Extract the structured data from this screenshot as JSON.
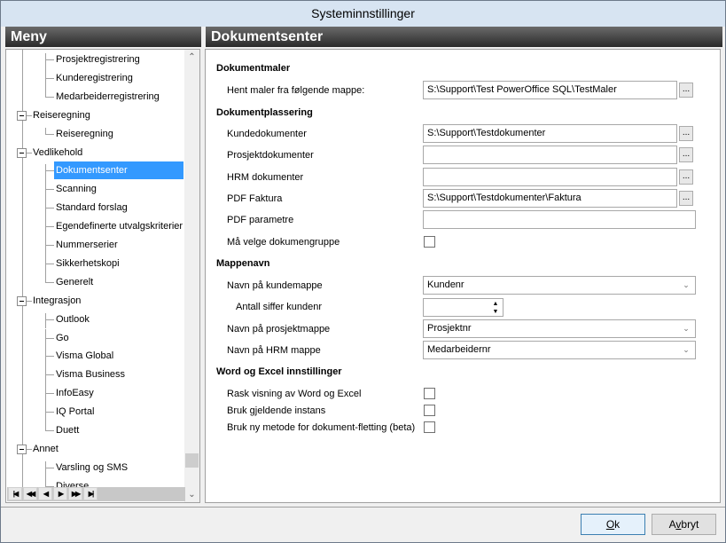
{
  "window": {
    "title": "Systeminnstillinger"
  },
  "menu": {
    "title": "Meny",
    "items": [
      {
        "label": "Prosjektregistrering",
        "level": 2
      },
      {
        "label": "Kunderegistrering",
        "level": 2
      },
      {
        "label": "Medarbeiderregistrering",
        "level": 2
      },
      {
        "label": "Reiseregning",
        "level": 1,
        "expanded": true
      },
      {
        "label": "Reiseregning",
        "level": 2
      },
      {
        "label": "Vedlikehold",
        "level": 1,
        "expanded": true
      },
      {
        "label": "Dokumentsenter",
        "level": 2,
        "selected": true
      },
      {
        "label": "Scanning",
        "level": 2
      },
      {
        "label": "Standard forslag",
        "level": 2
      },
      {
        "label": "Egendefinerte utvalgskriterier",
        "level": 2
      },
      {
        "label": "Nummerserier",
        "level": 2
      },
      {
        "label": "Sikkerhetskopi",
        "level": 2
      },
      {
        "label": "Generelt",
        "level": 2
      },
      {
        "label": "Integrasjon",
        "level": 1,
        "expanded": true
      },
      {
        "label": "Outlook",
        "level": 2
      },
      {
        "label": "Go",
        "level": 2
      },
      {
        "label": "Visma Global",
        "level": 2
      },
      {
        "label": "Visma Business",
        "level": 2
      },
      {
        "label": "InfoEasy",
        "level": 2
      },
      {
        "label": "IQ Portal",
        "level": 2
      },
      {
        "label": "Duett",
        "level": 2
      },
      {
        "label": "Annet",
        "level": 1,
        "expanded": true
      },
      {
        "label": "Varsling og SMS",
        "level": 2
      },
      {
        "label": "Diverse",
        "level": 2
      }
    ],
    "nav_buttons": [
      "first",
      "prev-page",
      "prev",
      "next",
      "next-page",
      "last"
    ]
  },
  "content": {
    "title": "Dokumentsenter",
    "sections": {
      "dokumentmaler": "Dokumentmaler",
      "dokumentplassering": "Dokumentplassering",
      "mappenavn": "Mappenavn",
      "word_excel": "Word og Excel innstillinger"
    },
    "fields": {
      "hent_maler": {
        "label": "Hent maler fra følgende mappe:",
        "value": "S:\\Support\\Test PowerOffice SQL\\TestMaler"
      },
      "kundedokumenter": {
        "label": "Kundedokumenter",
        "value": "S:\\Support\\Testdokumenter"
      },
      "prosjektdokumenter": {
        "label": "Prosjektdokumenter",
        "value": ""
      },
      "hrm_dokumenter": {
        "label": "HRM dokumenter",
        "value": ""
      },
      "pdf_faktura": {
        "label": "PDF Faktura",
        "value": "S:\\Support\\Testdokumenter\\Faktura"
      },
      "pdf_parametre": {
        "label": "PDF parametre",
        "value": ""
      },
      "maa_velge": {
        "label": "Må velge dokumengruppe",
        "checked": false
      },
      "navn_kundemappe": {
        "label": "Navn på kundemappe",
        "value": "Kundenr"
      },
      "antall_siffer": {
        "label": "Antall siffer kundenr",
        "value": ""
      },
      "navn_prosjektmappe": {
        "label": "Navn på prosjektmappe",
        "value": "Prosjektnr"
      },
      "navn_hrm_mappe": {
        "label": "Navn på HRM mappe",
        "value": "Medarbeidernr"
      },
      "rask_visning": {
        "label": "Rask visning av Word og Excel",
        "checked": false
      },
      "bruk_gjeldende": {
        "label": "Bruk gjeldende instans",
        "checked": false
      },
      "bruk_ny_metode": {
        "label": "Bruk ny metode for dokument-fletting (beta)",
        "checked": false
      }
    },
    "browse_label": "..."
  },
  "footer": {
    "ok_label": "Ok",
    "cancel_label": "Avbryt"
  }
}
